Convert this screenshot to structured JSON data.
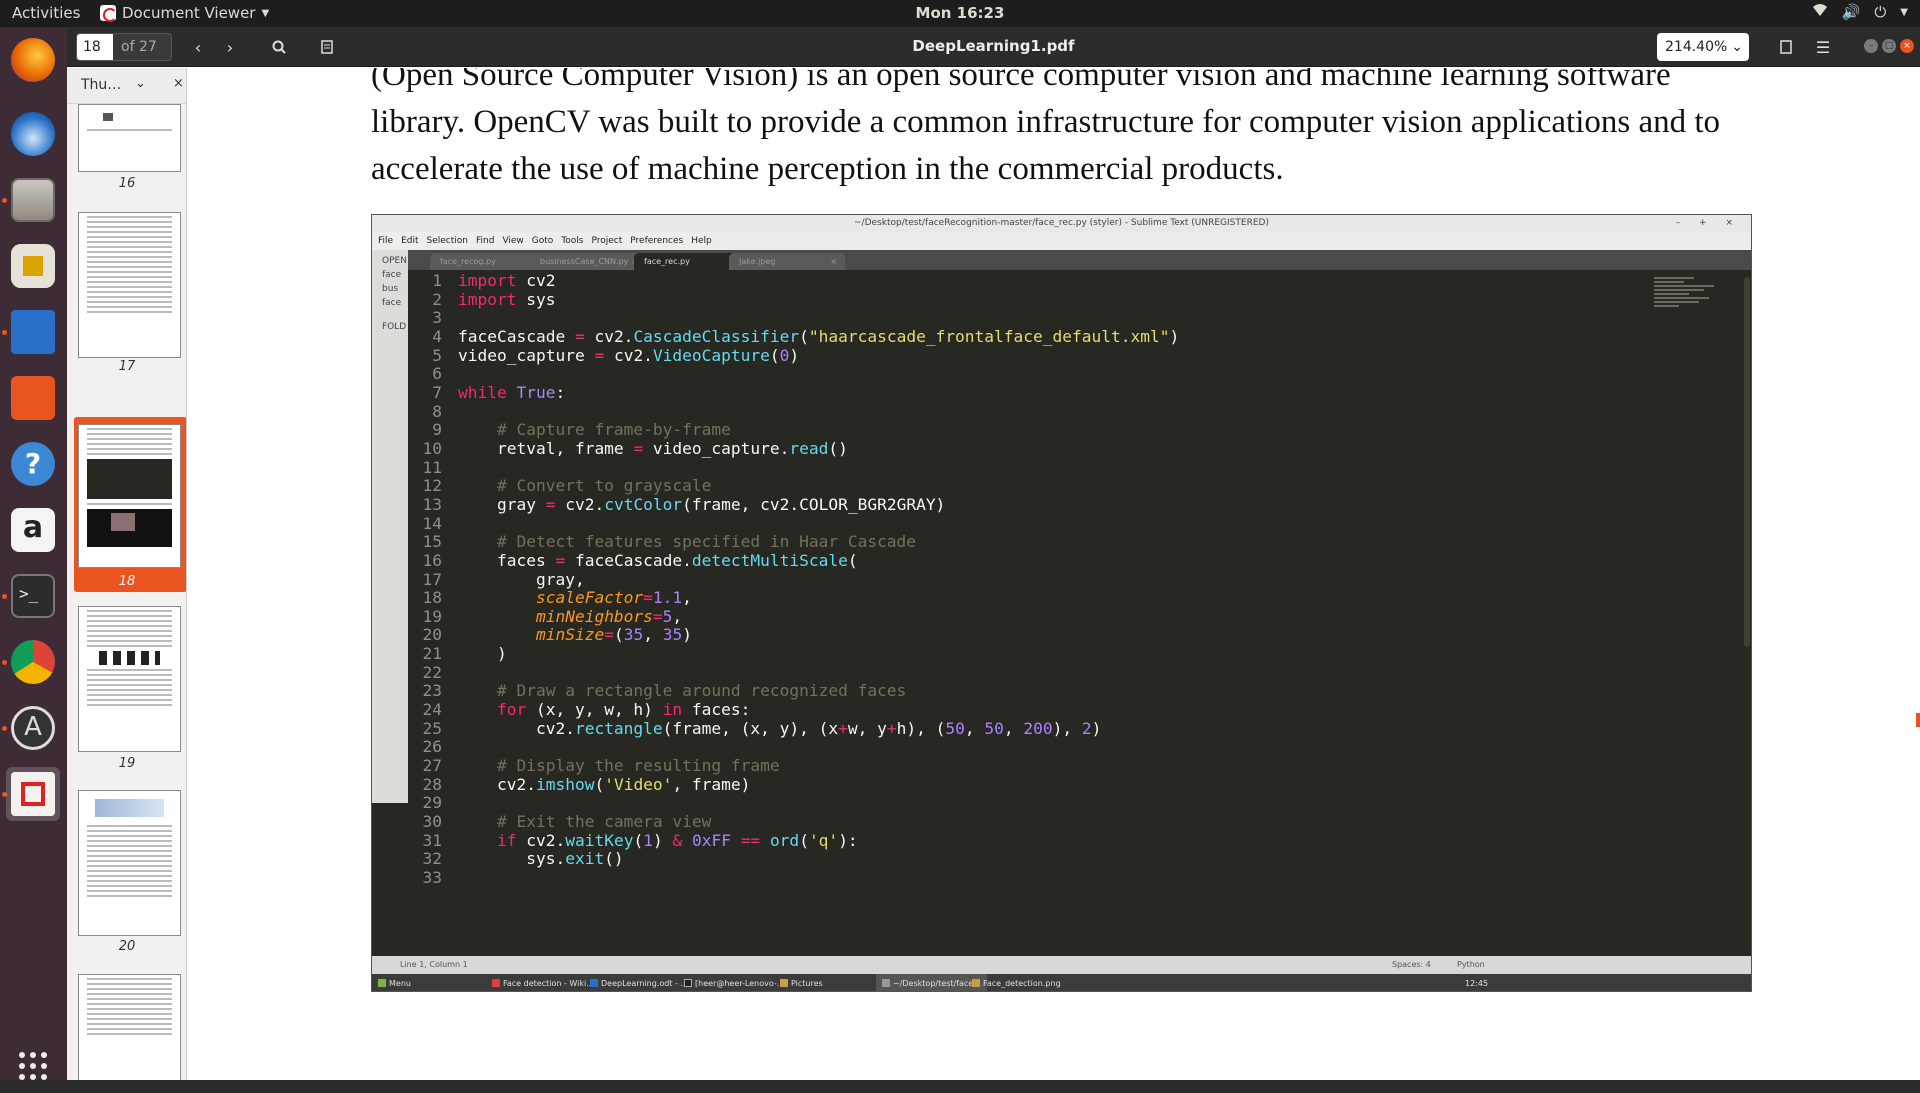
{
  "topbar": {
    "activities": "Activities",
    "app_name": "Document Viewer",
    "clock": "Mon 16:23"
  },
  "viewer": {
    "page_current": "18",
    "page_total_label": "of 27",
    "title": "DeepLearning1.pdf",
    "zoom": "214.40%"
  },
  "sidebar": {
    "mode_label": "Thu…",
    "thumbnails": [
      {
        "number": "16"
      },
      {
        "number": "17"
      },
      {
        "number": "18",
        "selected": true
      },
      {
        "number": "19"
      },
      {
        "number": "20"
      }
    ]
  },
  "document": {
    "paragraph": "(Open Source Computer Vision) is an open source computer vision and machine learning software library. OpenCV was built to provide a common infrastructure for computer vision applications and to accelerate the use of machine perception in the commercial products."
  },
  "figure": {
    "window_title": "~/Desktop/test/faceRecognition-master/face_rec.py (styler) - Sublime Text (UNREGISTERED)",
    "menu": [
      "File",
      "Edit",
      "Selection",
      "Find",
      "View",
      "Goto",
      "Tools",
      "Project",
      "Preferences",
      "Help"
    ],
    "tabs": [
      "face_recog.py",
      "businessCase_CNN.py",
      "face_rec.py",
      "Jake.jpeg"
    ],
    "active_tab": "face_rec.py",
    "sidebar_labels": [
      "OPEN",
      "face",
      "bus",
      "face",
      "FOLD"
    ],
    "status_left": "Line 1, Column 1",
    "status_spaces": "Spaces: 4",
    "status_lang": "Python",
    "taskbar": {
      "menu": "Menu",
      "items": [
        "Face detection - Wiki...",
        "DeepLearning.odt - ...",
        "[heer@heer-Lenovo-...",
        "Pictures",
        "~/Desktop/test/face...",
        "Face_detection.png"
      ],
      "clock": "12:45"
    }
  },
  "colors": {
    "accent": "#e95420",
    "editor_bg": "#272822",
    "keyword": "#f92672",
    "function": "#66d9ef",
    "string": "#e6db74",
    "number": "#ae81ff",
    "comment": "#75715e",
    "param": "#fd971f"
  }
}
